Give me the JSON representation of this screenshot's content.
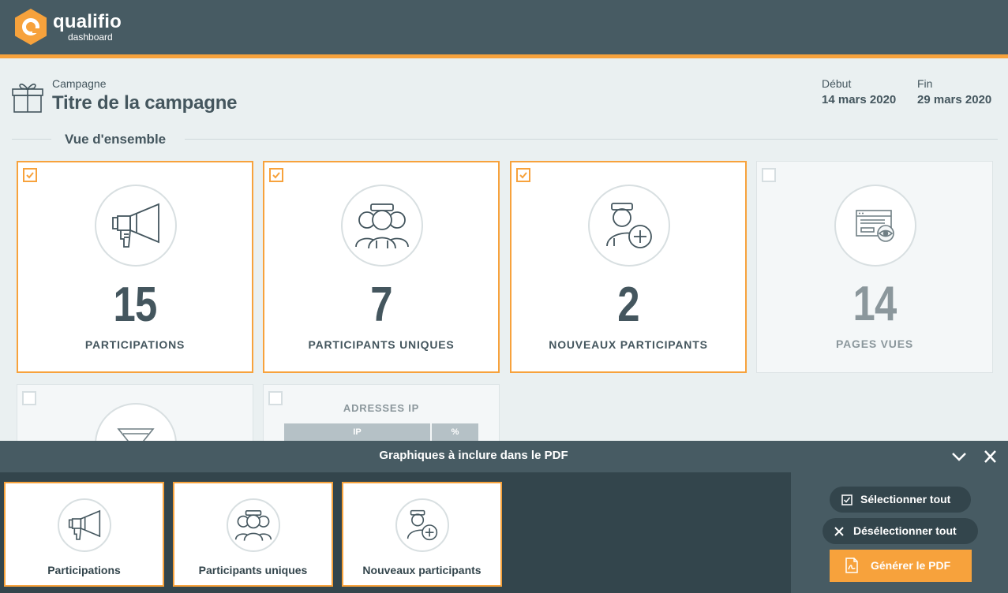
{
  "app": {
    "brand_name": "qualifio",
    "brand_sub": "dashboard",
    "colors": {
      "header": "#475b63",
      "accent": "#f7a23c",
      "background": "#eaf0f1",
      "panel": "#33454c"
    }
  },
  "campaign": {
    "label": "Campagne",
    "title": "Titre de la campagne",
    "start_label": "Début",
    "start_date": "14 mars 2020",
    "end_label": "Fin",
    "end_date": "29 mars 2020"
  },
  "overview": {
    "section_title": "Vue d'ensemble",
    "cards": [
      {
        "value": "15",
        "label": "PARTICIPATIONS",
        "checked": true,
        "icon": "megaphone-icon"
      },
      {
        "value": "7",
        "label": "PARTICIPANTS UNIQUES",
        "checked": true,
        "icon": "users-icon"
      },
      {
        "value": "2",
        "label": "NOUVEAUX PARTICIPANTS",
        "checked": true,
        "icon": "user-add-icon"
      },
      {
        "value": "14",
        "label": "PAGES VUES",
        "checked": false,
        "icon": "browser-eye-icon"
      }
    ],
    "funnel_card": {
      "checked": false,
      "icon": "funnel-icon"
    },
    "ip_card": {
      "checked": false,
      "title": "ADRESSES IP",
      "columns": [
        "IP",
        "%"
      ]
    }
  },
  "pdf_panel": {
    "title": "Graphiques à inclure dans le PDF",
    "items": [
      {
        "label": "Participations",
        "icon": "megaphone-icon"
      },
      {
        "label": "Participants uniques",
        "icon": "users-icon"
      },
      {
        "label": "Nouveaux participants",
        "icon": "user-add-icon"
      }
    ],
    "select_all": "Sélectionner tout",
    "deselect_all": "Désélectionner tout",
    "generate": "Générer le PDF"
  }
}
